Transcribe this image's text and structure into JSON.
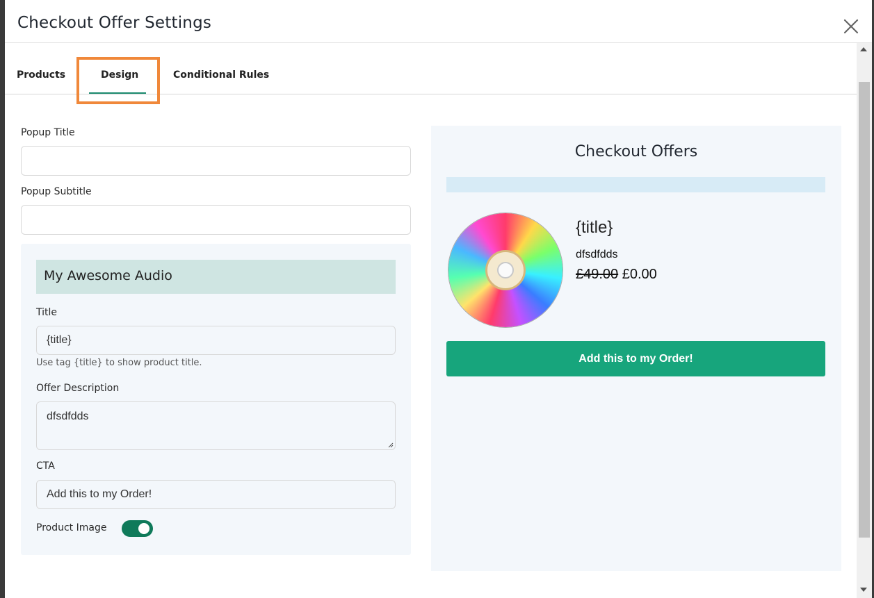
{
  "modal": {
    "title": "Checkout Offer Settings"
  },
  "tabs": [
    {
      "label": "Products"
    },
    {
      "label": "Design"
    },
    {
      "label": "Conditional Rules"
    }
  ],
  "form": {
    "popup_title_label": "Popup Title",
    "popup_title_value": "",
    "popup_subtitle_label": "Popup Subtitle",
    "popup_subtitle_value": ""
  },
  "product": {
    "name": "My Awesome Audio",
    "title_label": "Title",
    "title_value": "{title}",
    "title_help": "Use tag {title} to show product title.",
    "description_label": "Offer Description",
    "description_value": "dfsdfdds",
    "cta_label": "CTA",
    "cta_value": "Add this to my Order!",
    "image_label": "Product Image",
    "image_enabled": true
  },
  "preview": {
    "heading": "Checkout Offers",
    "title": "{title}",
    "description": "dfsdfdds",
    "old_price": "£49.00",
    "new_price": "£0.00",
    "cta": "Add this to my Order!"
  },
  "colors": {
    "accent": "#17a57c",
    "toggle_on": "#0f7a5a",
    "highlight": "#f0883a"
  }
}
